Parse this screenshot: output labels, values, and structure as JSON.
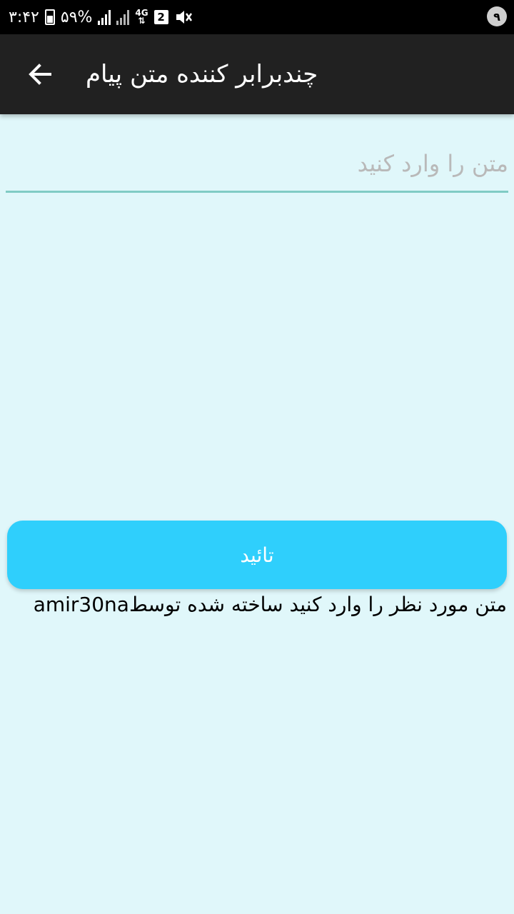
{
  "status_bar": {
    "time": "۳:۴۲",
    "battery": "۵۹%",
    "network": "4G",
    "sim": "2",
    "notification_badge": "۹"
  },
  "app_bar": {
    "title": "چندبرابر کننده متن پیام",
    "back_icon": "arrow-back-icon"
  },
  "input": {
    "placeholder": "متن را وارد کنید",
    "value": ""
  },
  "confirm_button": {
    "label": "تائید"
  },
  "footer": {
    "text": "متن مورد نظر را وارد کنید ساخته شده توسطamir30na"
  },
  "colors": {
    "background": "#e0f7fa",
    "app_bar": "#212121",
    "button": "#2fcffc",
    "input_underline": "#80cbc4"
  }
}
